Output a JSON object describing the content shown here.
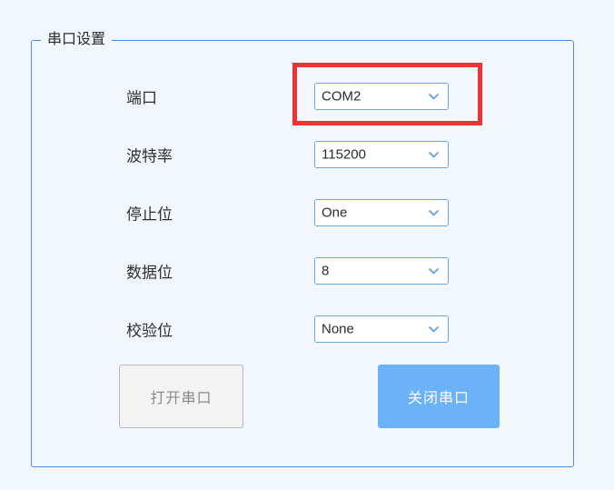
{
  "panel": {
    "title": "串口设置"
  },
  "form": {
    "rows": [
      {
        "label": "端口",
        "value": "COM2",
        "icon": "chevron-down-icon",
        "name": "port"
      },
      {
        "label": "波特率",
        "value": "115200",
        "icon": "chevron-down-icon",
        "name": "baud-rate"
      },
      {
        "label": "停止位",
        "value": "One",
        "icon": "chevron-down-icon",
        "name": "stop-bits"
      },
      {
        "label": "数据位",
        "value": "8",
        "icon": "chevron-down-icon",
        "name": "data-bits"
      },
      {
        "label": "校验位",
        "value": "None",
        "icon": "chevron-down-icon",
        "name": "parity"
      }
    ]
  },
  "buttons": {
    "open_label": "打开串口",
    "close_label": "关闭串口"
  },
  "annotation": {
    "type": "highlight-rectangle",
    "target": "端口",
    "color": "#ef3233"
  },
  "colors": {
    "background": "#f2f6fd",
    "panel_border": "#4a90e2",
    "dropdown_border": "#6ba5e7",
    "accent_button": "#6cb2f8",
    "disabled_button": "#f3f3f3",
    "highlight": "#ef3233"
  }
}
